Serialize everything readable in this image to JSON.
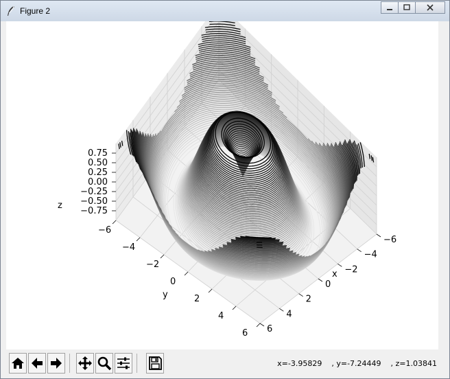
{
  "window": {
    "title": "Figure 2"
  },
  "toolbar": {
    "buttons": [
      {
        "name": "home",
        "icon": "home-icon"
      },
      {
        "name": "back",
        "icon": "arrow-left-icon"
      },
      {
        "name": "forward",
        "icon": "arrow-right-icon"
      },
      {
        "name": "pan",
        "icon": "move-icon"
      },
      {
        "name": "zoom",
        "icon": "magnifier-icon"
      },
      {
        "name": "configure",
        "icon": "sliders-icon"
      },
      {
        "name": "save",
        "icon": "floppy-disk-icon"
      }
    ],
    "x_readout": "x=-3.95829",
    "y_readout": "y=-7.24449",
    "z_readout": "z=1.03841"
  },
  "chart_data": {
    "type": "contour3d",
    "function": "sin(sqrt(x^2 + y^2))",
    "colormap": "binary",
    "xlabel": "x",
    "ylabel": "y",
    "zlabel": "z",
    "x_ticks": [
      "−6",
      "−4",
      "−2",
      "0",
      "2",
      "4",
      "6"
    ],
    "y_ticks": [
      "−6",
      "−4",
      "−2",
      "0",
      "2",
      "4",
      "6"
    ],
    "z_ticks": [
      "−0.75",
      "−0.50",
      "−0.25",
      "0.00",
      "0.25",
      "0.50",
      "0.75"
    ],
    "xlim": [
      -6,
      6
    ],
    "ylim": [
      -6,
      6
    ],
    "zlim": [
      -1,
      1
    ],
    "grid": true
  }
}
